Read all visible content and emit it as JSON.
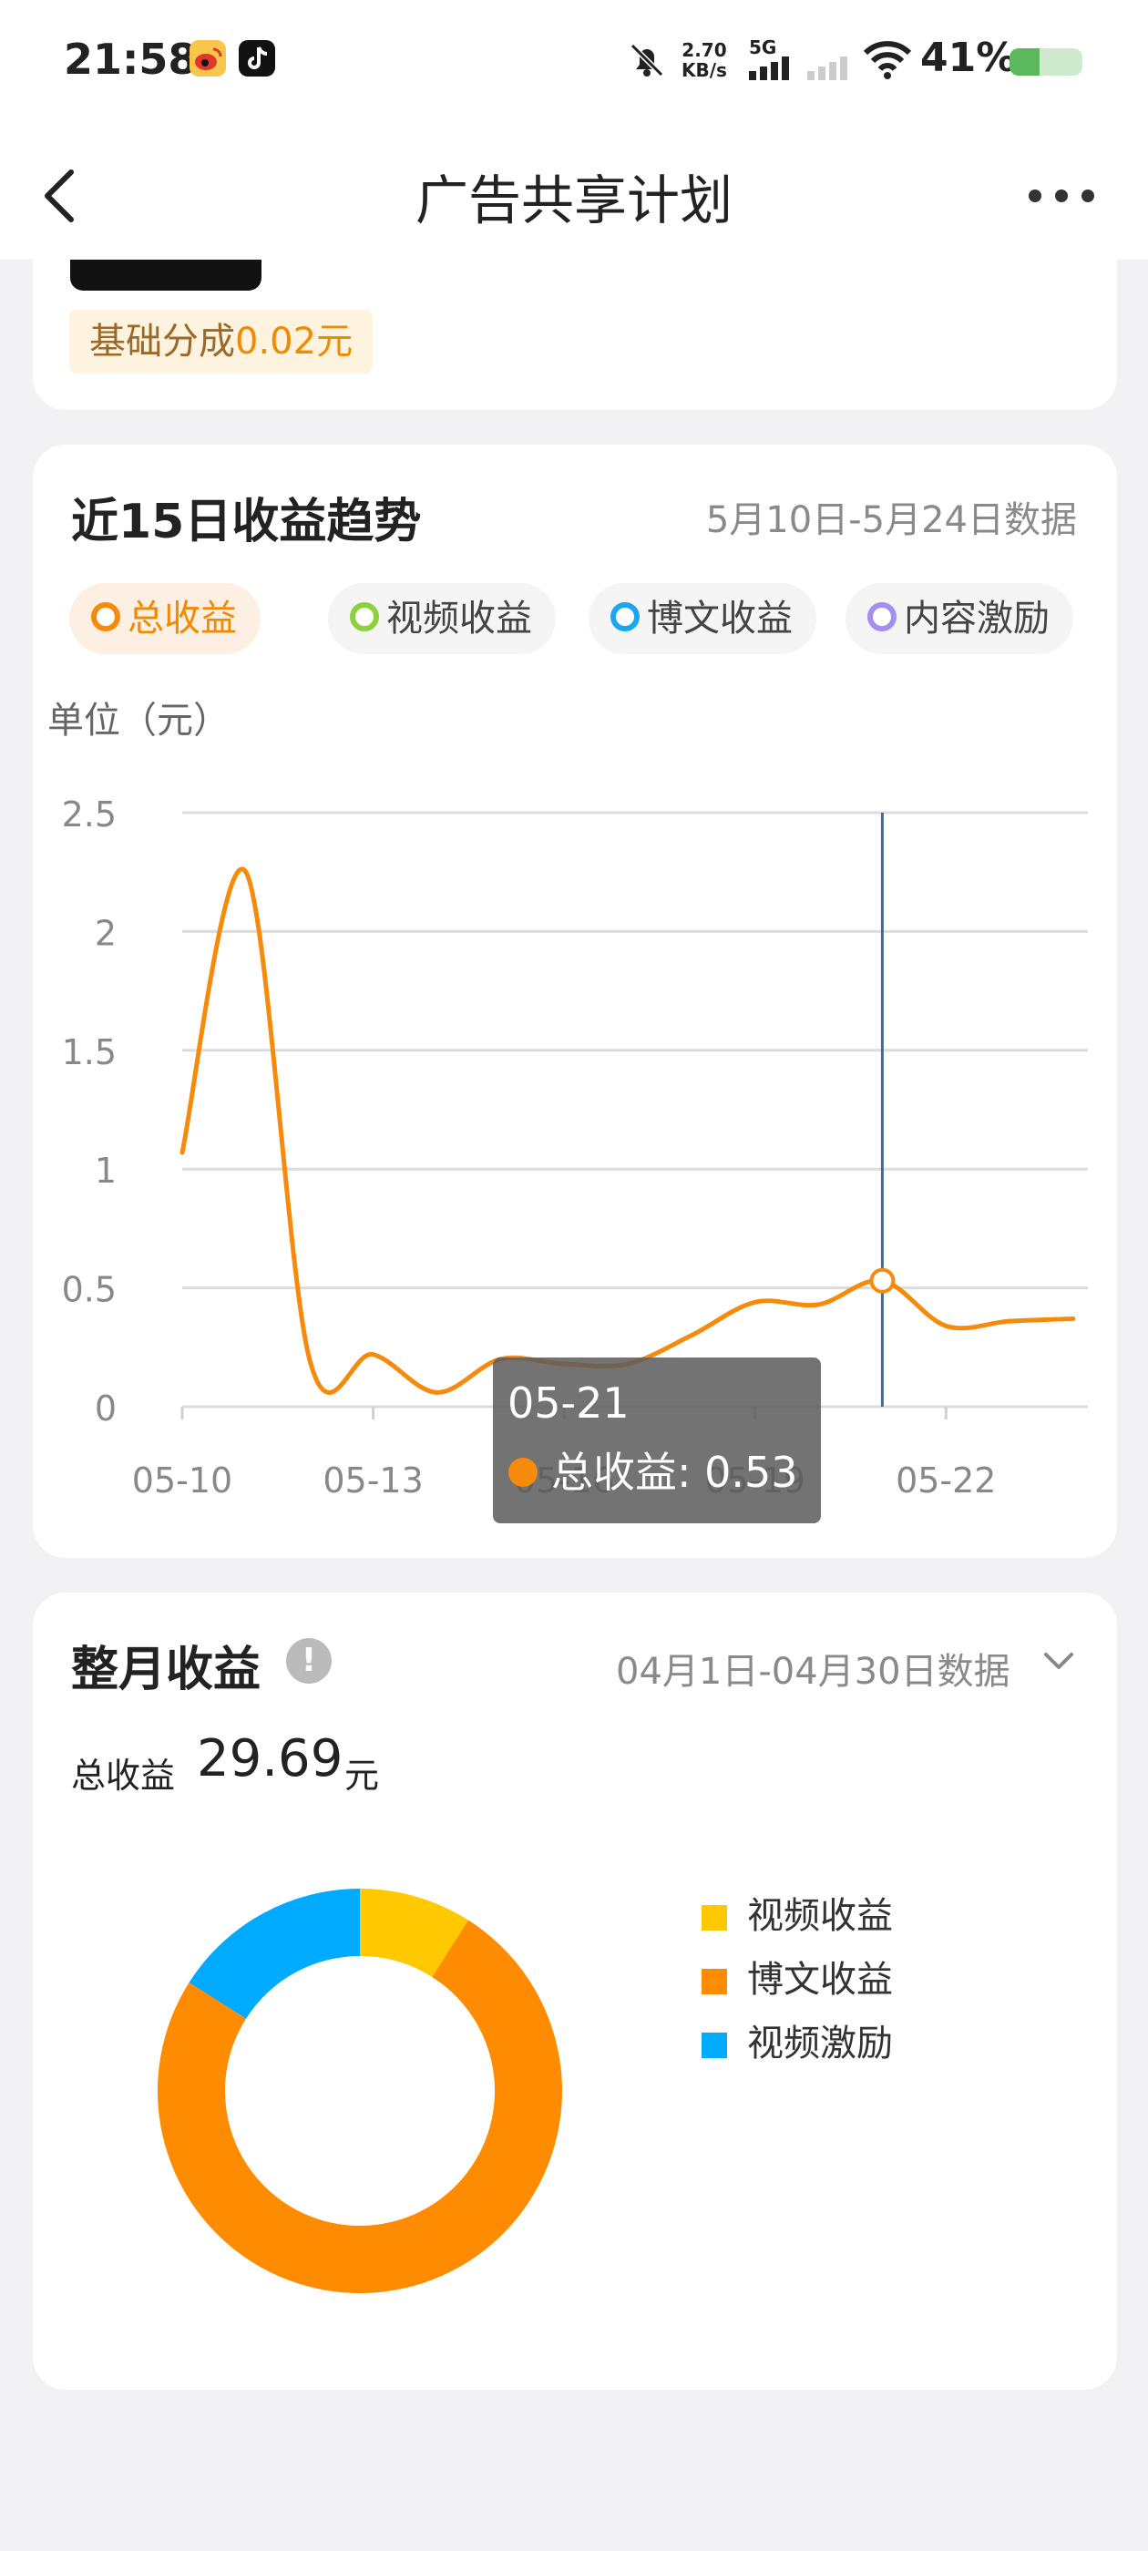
{
  "status_bar": {
    "time": "21:58",
    "speed_value": "2.70",
    "speed_unit": "KB/s",
    "network": "5G",
    "battery": "41%",
    "battery_level": 0.41,
    "icons": [
      "weibo-app-icon",
      "tiktok-app-icon",
      "mute-bell-icon",
      "signal-icon",
      "wifi-icon",
      "battery-icon"
    ]
  },
  "nav": {
    "title": "广告共享计划"
  },
  "top_card": {
    "base_share_label": "基础分成",
    "base_share_value": "0.02元"
  },
  "trend": {
    "title": "近15日收益趋势",
    "range": "5月10日-5月24日数据",
    "chips": [
      {
        "label": "总收益",
        "color": "#f58a0b",
        "active": true
      },
      {
        "label": "视频收益",
        "color": "#8dd13d",
        "active": false
      },
      {
        "label": "博文收益",
        "color": "#1aa6f0",
        "active": false
      },
      {
        "label": "内容激励",
        "color": "#a48ef0",
        "active": false
      }
    ],
    "unit_label": "单位（元）",
    "tooltip": {
      "date": "05-21",
      "series": "总收益",
      "value": "0.53"
    }
  },
  "chart_data": [
    {
      "type": "line",
      "x": [
        "05-10",
        "05-11",
        "05-12",
        "05-13",
        "05-14",
        "05-15",
        "05-16",
        "05-17",
        "05-18",
        "05-19",
        "05-20",
        "05-21",
        "05-22",
        "05-23",
        "05-24"
      ],
      "x_tick_labels": [
        "05-10",
        "05-13",
        "05-16",
        "05-19",
        "05-22"
      ],
      "series": [
        {
          "name": "总收益",
          "color": "#f58a0b",
          "values": [
            1.07,
            2.25,
            0.2,
            0.22,
            0.06,
            0.2,
            0.18,
            0.18,
            0.3,
            0.44,
            0.43,
            0.53,
            0.34,
            0.36,
            0.37
          ]
        }
      ],
      "ylim": [
        0,
        2.5
      ],
      "y_ticks": [
        "0",
        "0.5",
        "1",
        "1.5",
        "2",
        "2.5"
      ],
      "grid": true,
      "highlight_index": 11,
      "highlight_line_color": "#3b6fa0"
    },
    {
      "type": "pie",
      "title": "整月收益",
      "range": "04月1日-04月30日数据",
      "total_label": "总收益",
      "total_value": "29.69",
      "total_unit": "元",
      "categories": [
        "视频收益",
        "博文收益",
        "视频激励"
      ],
      "colors": [
        "#ffc800",
        "#ff8c00",
        "#00aaff"
      ],
      "values": [
        0.09,
        0.75,
        0.16
      ]
    }
  ]
}
